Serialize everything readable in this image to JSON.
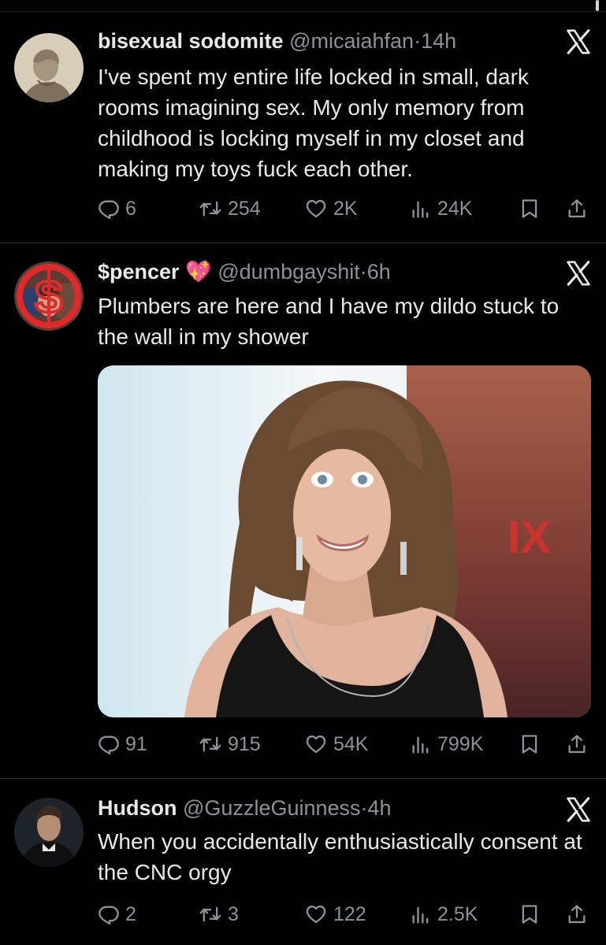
{
  "tweets": [
    {
      "display_name": "bisexual sodomite",
      "handle": "@micaiahfan",
      "time": "14h",
      "text": "I've spent my entire life locked in small, dark rooms imagining sex. My only memory from childhood is locking myself in my closet and making my toys fuck each other.",
      "replies": "6",
      "reposts": "254",
      "likes": "2K",
      "views": "24K"
    },
    {
      "display_name": "$pencer",
      "name_emoji": "💖",
      "handle": "@dumbgayshit",
      "time": "6h",
      "text": "Plumbers are here and I have my dildo stuck to the wall in my shower",
      "replies": "91",
      "reposts": "915",
      "likes": "54K",
      "views": "799K",
      "media_sign_text": "IX"
    },
    {
      "display_name": "Hudson",
      "handle": "@GuzzleGuinness",
      "time": "4h",
      "text": "When you accidentally enthusiastically consent at the CNC orgy",
      "replies": "2",
      "reposts": "3",
      "likes": "122",
      "views": "2.5K"
    }
  ],
  "separator": "·",
  "colors": {
    "background": "#000000",
    "text": "#e7e9ea",
    "muted": "#8b9298",
    "divider": "#2f3336"
  },
  "icons": [
    "reply-icon",
    "repost-icon",
    "like-icon",
    "views-icon",
    "bookmark-icon",
    "share-icon",
    "x-logo-icon"
  ]
}
